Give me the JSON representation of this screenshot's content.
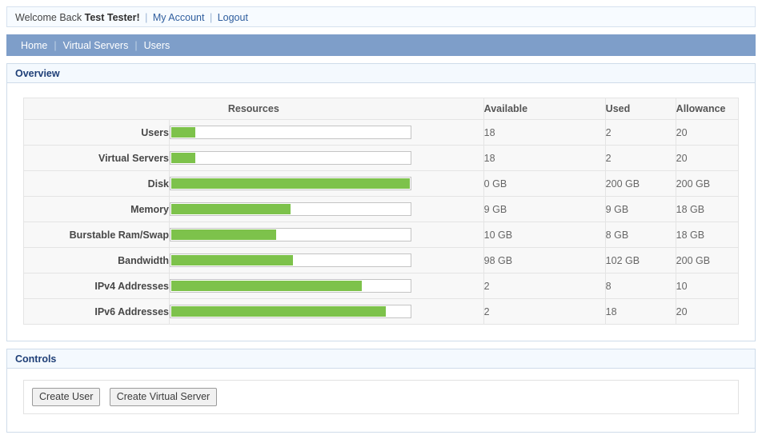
{
  "welcome": {
    "greeting": "Welcome Back",
    "username": "Test Tester!",
    "sep1": "|",
    "sep2": "|",
    "my_account": "My Account",
    "logout": "Logout"
  },
  "nav": {
    "items": [
      {
        "label": "Home"
      },
      {
        "label": "Virtual Servers"
      },
      {
        "label": "Users"
      }
    ],
    "separator": "|",
    "background_color": "#7e9ec9"
  },
  "overview": {
    "title": "Overview",
    "table": {
      "headers": {
        "resources": "Resources",
        "available": "Available",
        "used": "Used",
        "allowance": "Allowance"
      },
      "rows": [
        {
          "label": "Users",
          "percent": 10,
          "available": "18",
          "used": "2",
          "allowance": "20"
        },
        {
          "label": "Virtual Servers",
          "percent": 10,
          "available": "18",
          "used": "2",
          "allowance": "20"
        },
        {
          "label": "Disk",
          "percent": 100,
          "available": "0 GB",
          "used": "200 GB",
          "allowance": "200 GB"
        },
        {
          "label": "Memory",
          "percent": 50,
          "available": "9 GB",
          "used": "9 GB",
          "allowance": "18 GB"
        },
        {
          "label": "Burstable Ram/Swap",
          "percent": 44,
          "available": "10 GB",
          "used": "8 GB",
          "allowance": "18 GB"
        },
        {
          "label": "Bandwidth",
          "percent": 51,
          "available": "98 GB",
          "used": "102 GB",
          "allowance": "200 GB"
        },
        {
          "label": "IPv4 Addresses",
          "percent": 80,
          "available": "2",
          "used": "8",
          "allowance": "10"
        },
        {
          "label": "IPv6 Addresses",
          "percent": 90,
          "available": "2",
          "used": "18",
          "allowance": "20"
        }
      ]
    },
    "bar_fill_color": "#7dc24b"
  },
  "controls": {
    "title": "Controls",
    "buttons": [
      {
        "label": "Create User"
      },
      {
        "label": "Create Virtual Server"
      }
    ]
  }
}
